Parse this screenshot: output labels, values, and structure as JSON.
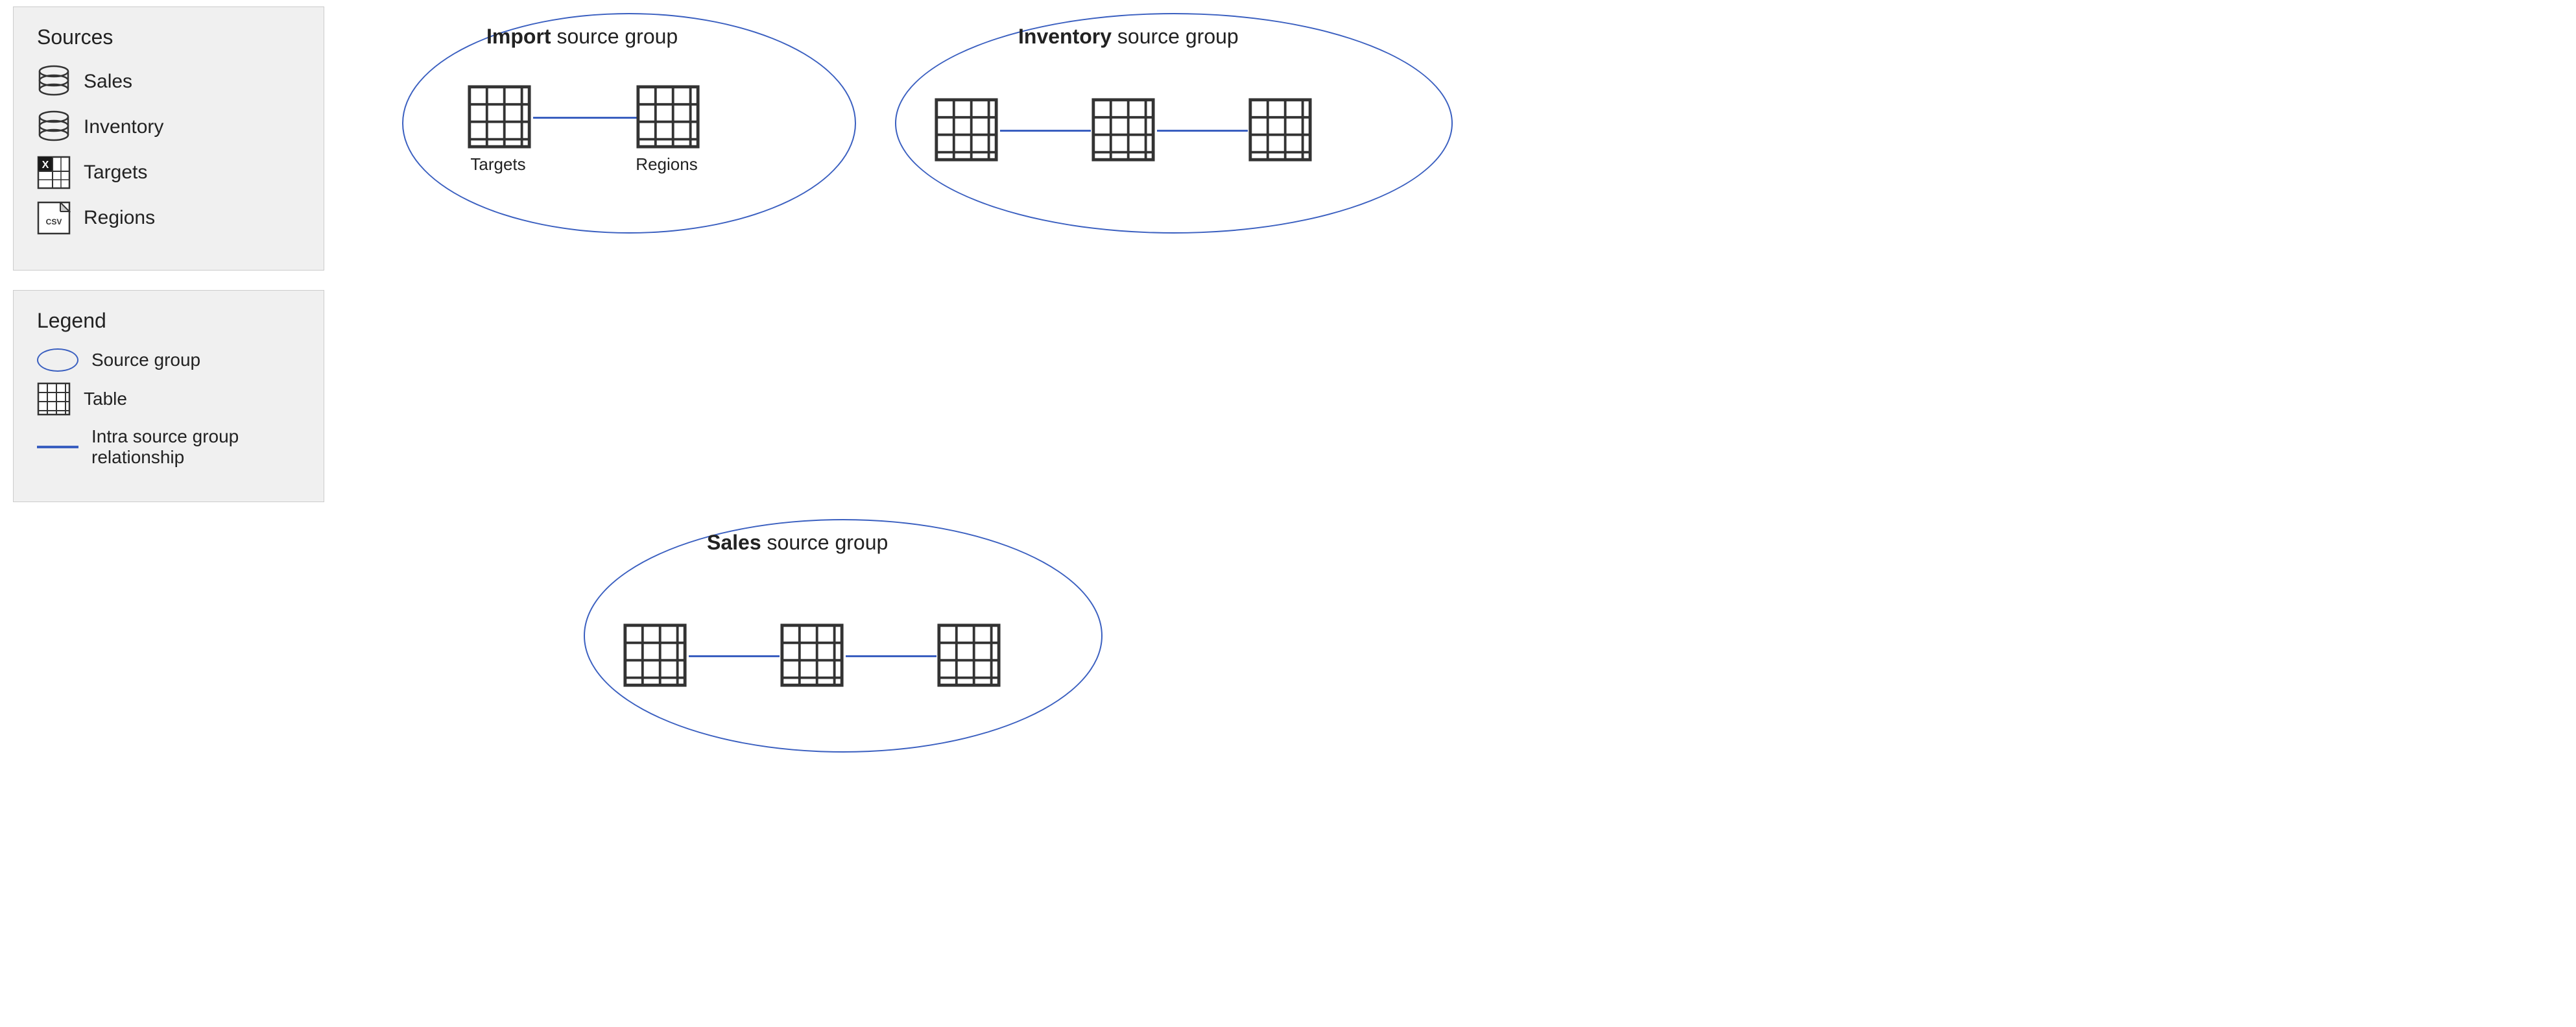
{
  "sources": {
    "title": "Sources",
    "items": [
      {
        "id": "sales",
        "label": "Sales",
        "icon": "database"
      },
      {
        "id": "inventory",
        "label": "Inventory",
        "icon": "database"
      },
      {
        "id": "targets",
        "label": "Targets",
        "icon": "excel"
      },
      {
        "id": "regions",
        "label": "Regions",
        "icon": "csv"
      }
    ]
  },
  "legend": {
    "title": "Legend",
    "items": [
      {
        "id": "source-group",
        "label": "Source group",
        "icon": "oval"
      },
      {
        "id": "table",
        "label": "Table",
        "icon": "table"
      },
      {
        "id": "relationship",
        "label": "Intra source group relationship",
        "icon": "line"
      }
    ]
  },
  "groups": {
    "import": {
      "title_bold": "Import",
      "title_rest": " source group",
      "tables": [
        "Targets",
        "Regions"
      ],
      "table_count": 2
    },
    "inventory": {
      "title_bold": "Inventory",
      "title_rest": " source group",
      "table_count": 3
    },
    "sales": {
      "title_bold": "Sales",
      "title_rest": " source group",
      "table_count": 3
    }
  },
  "colors": {
    "blue": "#3a5fc0",
    "border": "#ccc",
    "bg": "#f0f0f0"
  }
}
